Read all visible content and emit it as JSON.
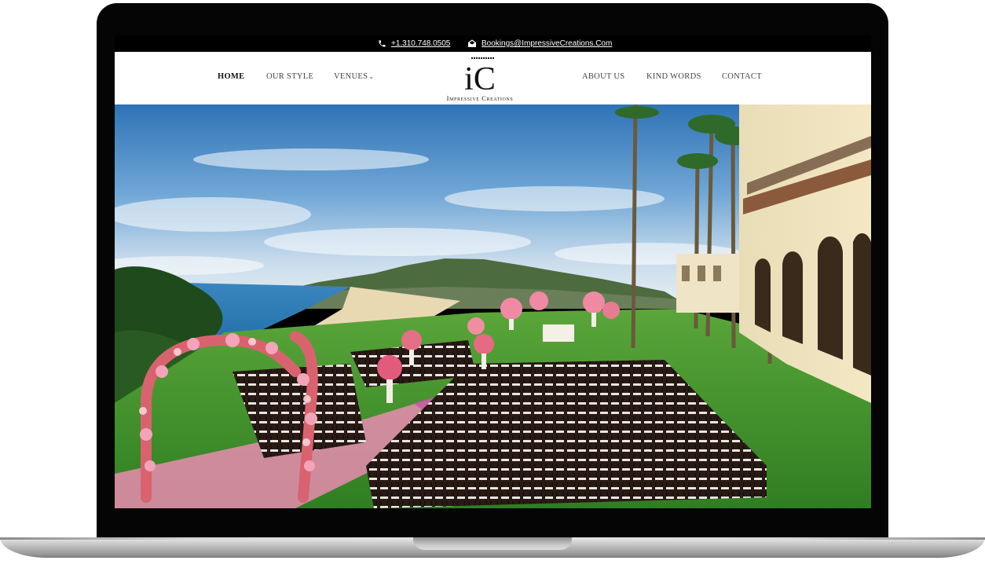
{
  "topbar": {
    "phone": "+1.310.748.0505",
    "email": "Bookings@ImpressiveCreations.Com",
    "phone_icon": "phone-icon",
    "email_icon": "envelope-icon"
  },
  "nav": {
    "left": [
      {
        "label": "HOME",
        "active": true
      },
      {
        "label": "OUR STYLE"
      },
      {
        "label": "VENUES"
      }
    ],
    "venues_dropdown_icon": "chevron-down-icon",
    "right": [
      {
        "label": "ABOUT US"
      },
      {
        "label": "KIND WORDS"
      },
      {
        "label": "CONTACT"
      }
    ]
  },
  "logo": {
    "monogram": "iC",
    "name": "Impressive Creations"
  },
  "hero": {
    "image": "wedding-ceremony-oceanview-photo"
  },
  "colors": {
    "nav_bg": "#ffffff",
    "topbar_bg": "#000000",
    "active_nav": "#111111",
    "nav_text": "#444444"
  }
}
